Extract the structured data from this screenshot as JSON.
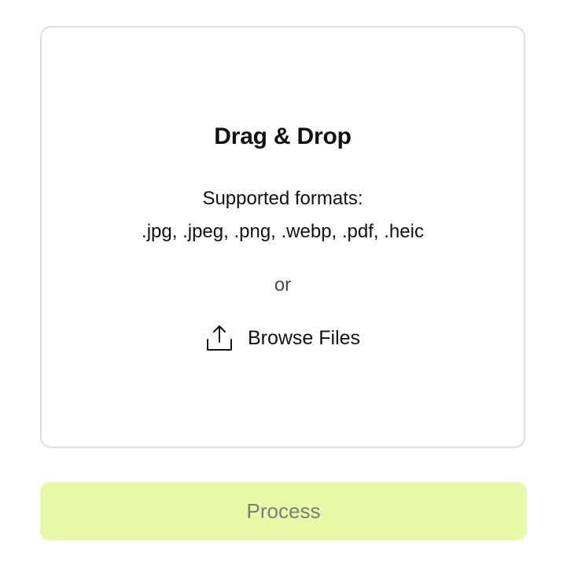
{
  "dropzone": {
    "title": "Drag & Drop",
    "formats_label": "Supported formats:",
    "formats_list": ".jpg, .jpeg, .png, .webp, .pdf, .heic",
    "separator": "or",
    "browse_label": "Browse Files",
    "browse_icon": "upload-icon"
  },
  "actions": {
    "process_label": "Process",
    "process_state": "disabled"
  },
  "colors": {
    "process_background": "#e8f9a8",
    "process_text": "#7c7c7c",
    "dropzone_border": "#dedede"
  }
}
